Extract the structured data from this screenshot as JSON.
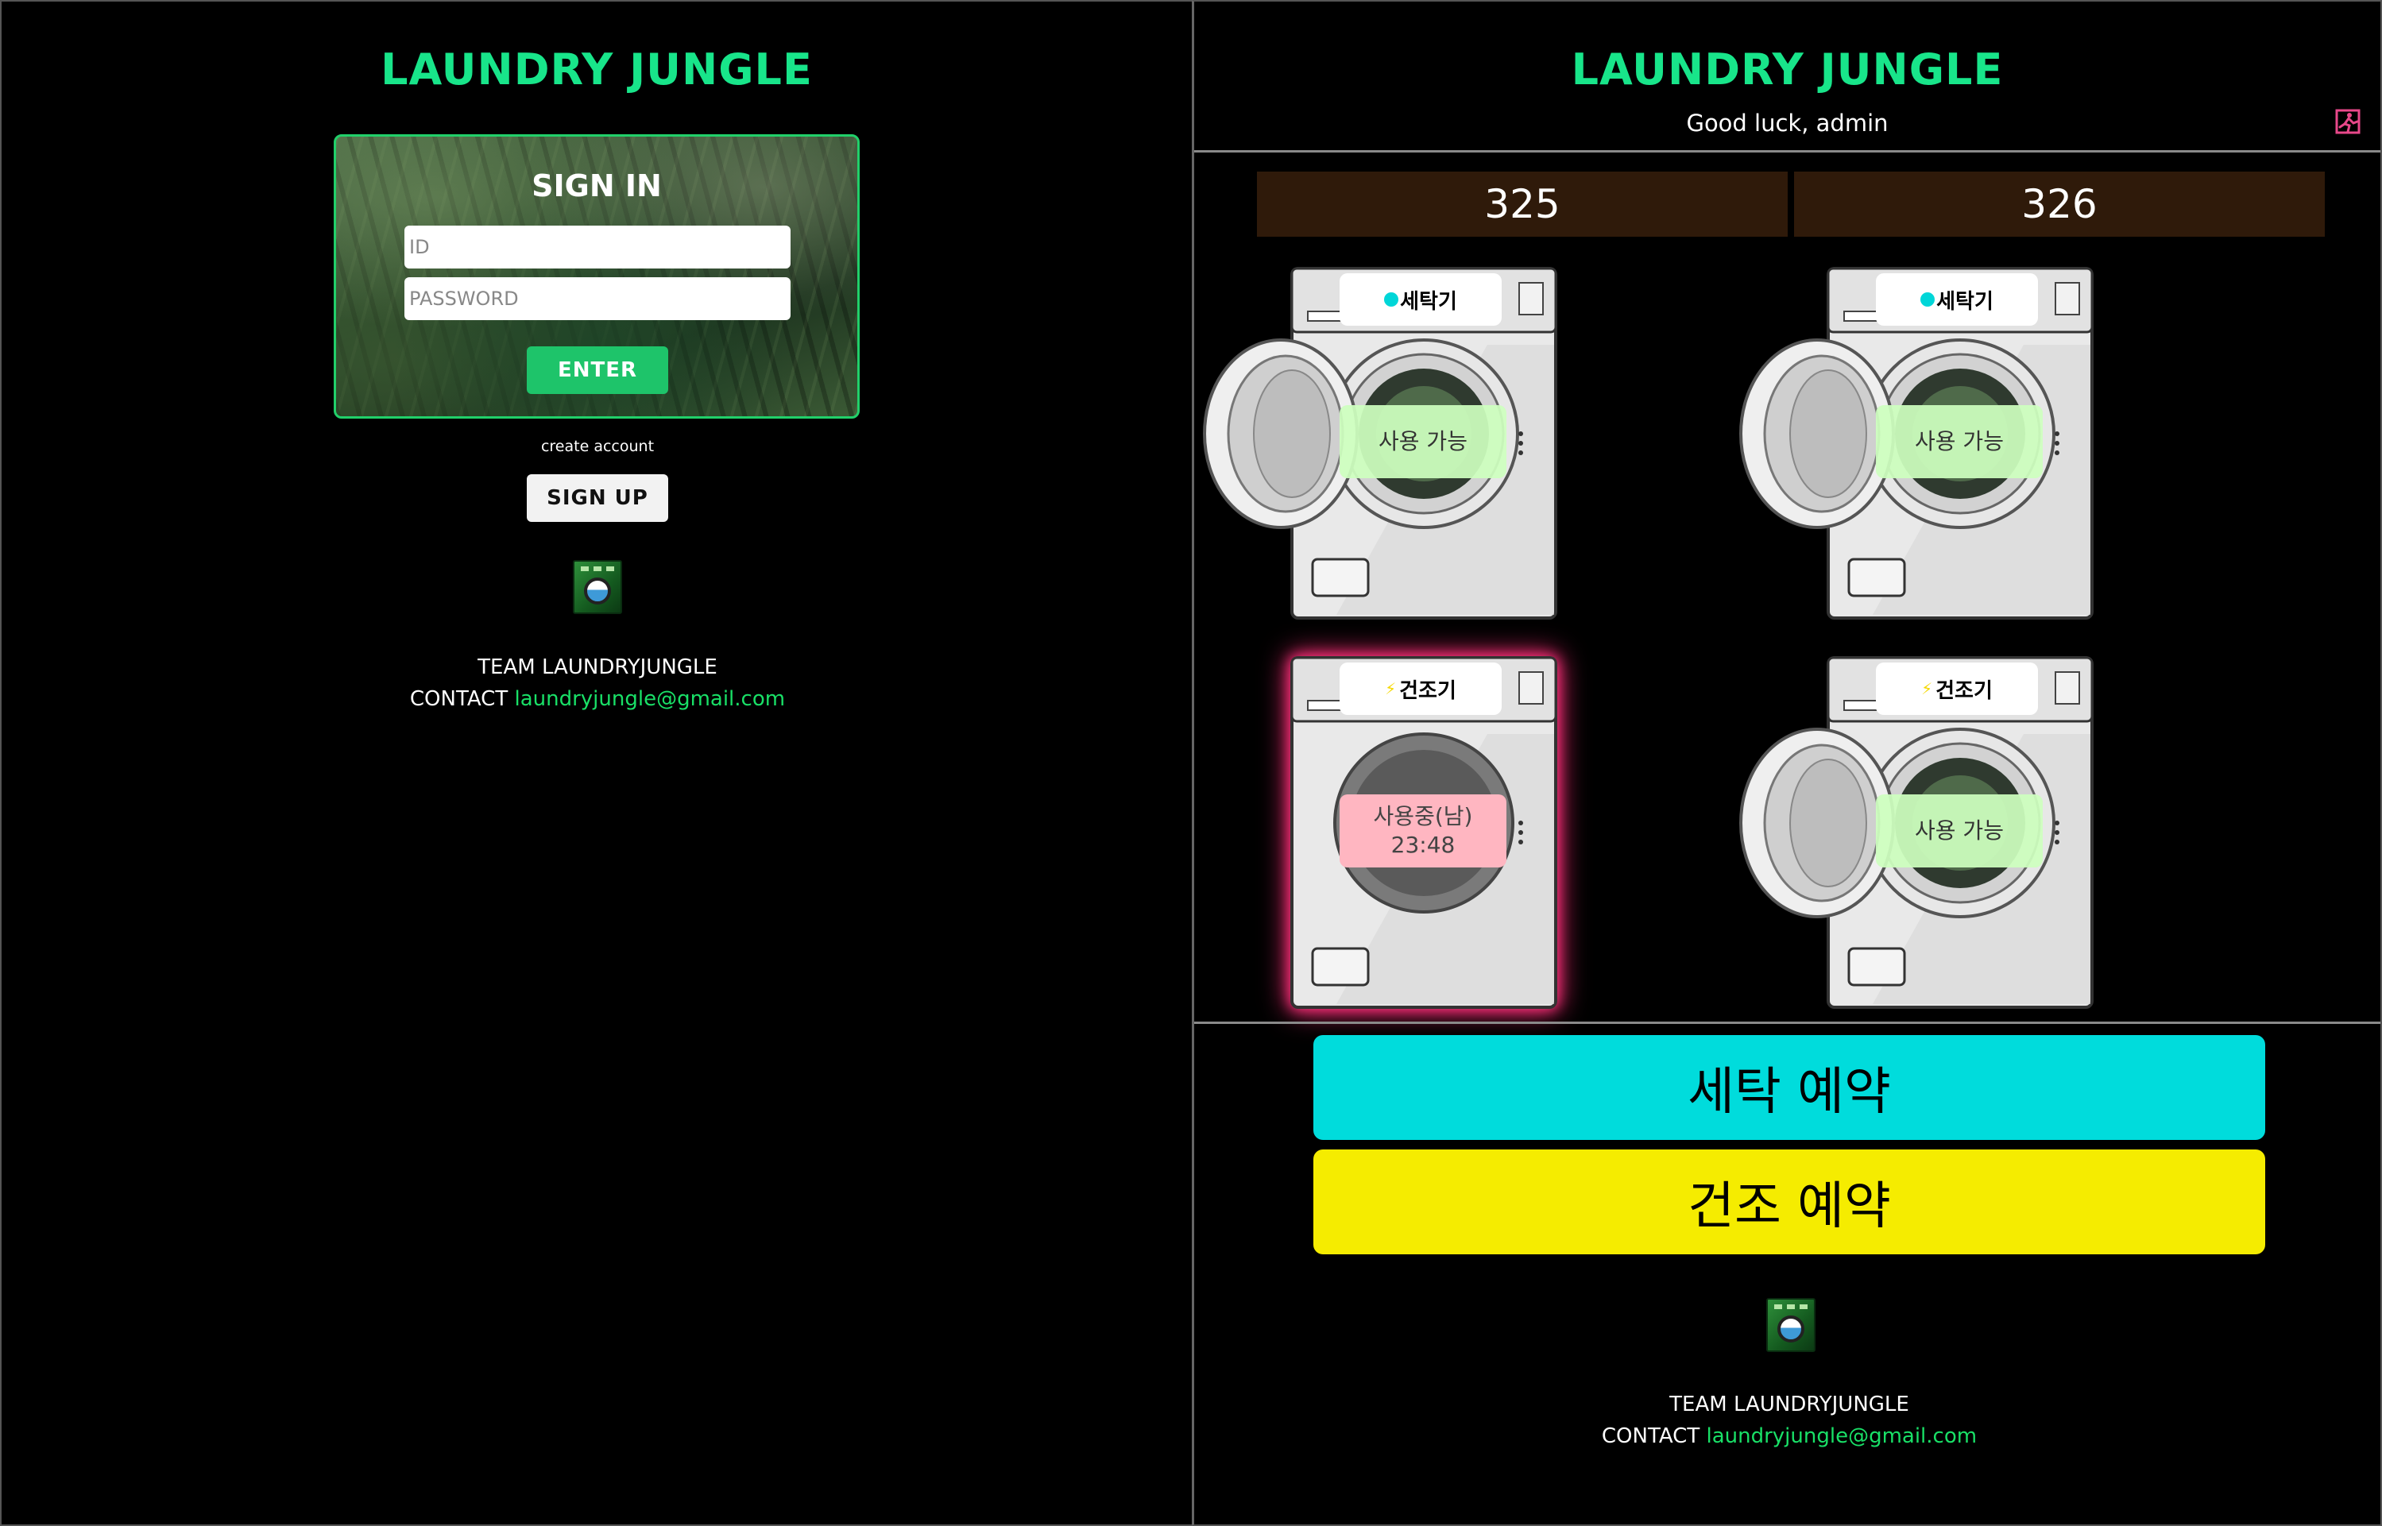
{
  "login": {
    "brand": "LAUNDRY JUNGLE",
    "signin_title": "SIGN IN",
    "id_placeholder": "ID",
    "password_placeholder": "PASSWORD",
    "enter_label": "ENTER",
    "create_account": "create account",
    "signup_label": "SIGN UP",
    "team": "TEAM LAUNDRYJUNGLE",
    "contact_label": "CONTACT",
    "contact_email": "laundryjungle@gmail.com"
  },
  "app": {
    "brand": "LAUNDRY JUNGLE",
    "greeting": "Good luck, admin",
    "rooms": [
      "325",
      "326"
    ],
    "machines": [
      {
        "type": "세탁기",
        "kind": "washer",
        "status": "사용 가능",
        "time": "",
        "door": "open"
      },
      {
        "type": "세탁기",
        "kind": "washer",
        "status": "사용 가능",
        "time": "",
        "door": "open"
      },
      {
        "type": "건조기",
        "kind": "dryer",
        "status": "사용중(남)",
        "time": "23:48",
        "door": "closed"
      },
      {
        "type": "건조기",
        "kind": "dryer",
        "status": "사용 가능",
        "time": "",
        "door": "open"
      }
    ],
    "wash_reserve": "세탁 예약",
    "dry_reserve": "건조 예약",
    "team": "TEAM LAUNDRYJUNGLE",
    "contact_label": "CONTACT",
    "contact_email": "laundryjungle@gmail.com"
  },
  "colors": {
    "brand_green": "#18e58a",
    "wash_button": "#00dcdc",
    "dry_button": "#f5ec00",
    "room_tab": "#2f1a0a",
    "in_use_glow": "#ff2f7a",
    "free_badge": "#cdffbe",
    "busy_badge": "#ffb6c1",
    "washer_dot": "#00d6d8",
    "dryer_bolt": "#f5d800"
  },
  "icons": {
    "logout": "exit-icon",
    "logo": "washing-machine-logo-icon"
  }
}
